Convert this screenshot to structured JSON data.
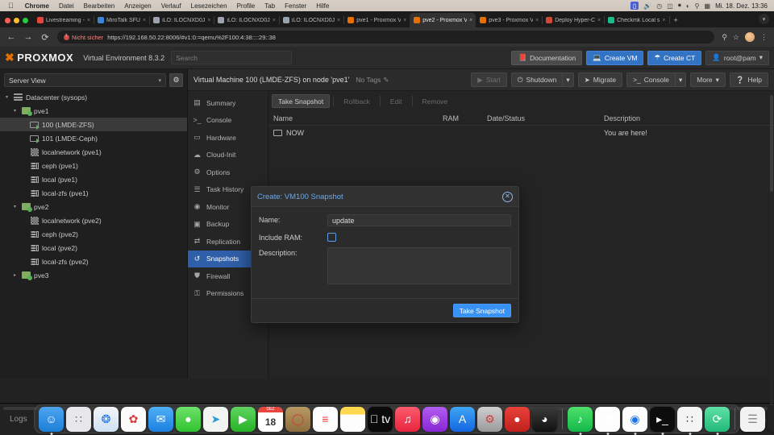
{
  "os_menubar": {
    "apple_icon": "apple-icon",
    "items": [
      "Chrome",
      "Datei",
      "Bearbeiten",
      "Anzeigen",
      "Verlauf",
      "Lesezeichen",
      "Profile",
      "Tab",
      "Fenster",
      "Hilfe"
    ],
    "status_icons": [
      "screen-share-icon",
      "volume-icon",
      "clock-icon",
      "battery-icon",
      "control-center-icon",
      "wifi-icon",
      "spotlight-icon",
      "display-icon"
    ],
    "clock": "Mi. 18. Dez.  13:36"
  },
  "browser": {
    "tabs": [
      {
        "title": "Livestreaming - ",
        "favicon": "#e8443a",
        "active": false
      },
      {
        "title": "MiroTalk SFU",
        "favicon": "#3a86d6",
        "active": false
      },
      {
        "title": "iLO: ILOCNXD0J",
        "favicon": "#9aa3ad",
        "active": false
      },
      {
        "title": "iLO: ILOCNXD0J",
        "favicon": "#9aa3ad",
        "active": false
      },
      {
        "title": "iLO: ILOCNXD0J",
        "favicon": "#9aa3ad",
        "active": false
      },
      {
        "title": "pve1 - Proxmox V",
        "favicon": "#e57000",
        "active": false
      },
      {
        "title": "pve2 - Proxmox V",
        "favicon": "#e57000",
        "active": true
      },
      {
        "title": "pve3 - Proxmox V",
        "favicon": "#e57000",
        "active": false
      },
      {
        "title": "Deploy Hyper-C",
        "favicon": "#d04a3a",
        "active": false
      },
      {
        "title": "Checkmk Local s",
        "favicon": "#1abb8b",
        "active": false
      }
    ],
    "new_tab_label": "+",
    "close_label": "×",
    "back_icon": "back-arrow-icon",
    "forward_icon": "forward-arrow-icon",
    "reload_icon": "reload-icon",
    "security_label": "Nicht sicher",
    "url": "https://192.168.50.22:8006/#v1:0:=qemu%2F100:4:38::::29::38",
    "zoom_icon": "zoom-search-icon",
    "bookmark_icon": "star-icon",
    "profile_icon": "avatar-icon",
    "menu_icon": "kebab-menu-icon"
  },
  "pve_header": {
    "logo_text": "PROXMOX",
    "product": "Virtual Environment 8.3.2",
    "search_placeholder": "Search",
    "documentation": "Documentation",
    "create_vm": "Create VM",
    "create_ct": "Create CT",
    "user": "root@pam"
  },
  "sidebar": {
    "view_label": "Server View",
    "gear_icon": "gear-icon",
    "tree": [
      {
        "label": "Datacenter (sysops)",
        "icon": "datacenter-icon",
        "indent": 0,
        "arrow": "down",
        "selected": false
      },
      {
        "label": "pve1",
        "icon": "node-icon",
        "indent": 1,
        "arrow": "down",
        "selected": false
      },
      {
        "label": "100 (LMDE-ZFS)",
        "icon": "vm-icon",
        "indent": 2,
        "arrow": "none",
        "selected": true
      },
      {
        "label": "101 (LMDE-Ceph)",
        "icon": "vm-icon",
        "indent": 2,
        "arrow": "none",
        "selected": false
      },
      {
        "label": "localnetwork (pve1)",
        "icon": "network-icon",
        "indent": 2,
        "arrow": "none",
        "selected": false
      },
      {
        "label": "ceph (pve1)",
        "icon": "storage-icon",
        "indent": 2,
        "arrow": "none",
        "selected": false
      },
      {
        "label": "local (pve1)",
        "icon": "storage-icon",
        "indent": 2,
        "arrow": "none",
        "selected": false
      },
      {
        "label": "local-zfs (pve1)",
        "icon": "storage-icon",
        "indent": 2,
        "arrow": "none",
        "selected": false
      },
      {
        "label": "pve2",
        "icon": "node-icon",
        "indent": 1,
        "arrow": "down",
        "selected": false
      },
      {
        "label": "localnetwork (pve2)",
        "icon": "network-icon",
        "indent": 2,
        "arrow": "none",
        "selected": false
      },
      {
        "label": "ceph (pve2)",
        "icon": "storage-icon",
        "indent": 2,
        "arrow": "none",
        "selected": false
      },
      {
        "label": "local (pve2)",
        "icon": "storage-icon",
        "indent": 2,
        "arrow": "none",
        "selected": false
      },
      {
        "label": "local-zfs (pve2)",
        "icon": "storage-icon",
        "indent": 2,
        "arrow": "none",
        "selected": false
      },
      {
        "label": "pve3",
        "icon": "node-icon",
        "indent": 1,
        "arrow": "right",
        "selected": false
      }
    ]
  },
  "vm_bar": {
    "title": "Virtual Machine 100 (LMDE-ZFS) on node 'pve1'",
    "tags_label": "No Tags",
    "tags_edit_icon": "pencil-icon",
    "start": "Start",
    "shutdown": "Shutdown",
    "migrate": "Migrate",
    "console": "Console",
    "more": "More",
    "help": "Help"
  },
  "vm_nav": [
    {
      "label": "Summary",
      "icon": "summary-icon",
      "active": false
    },
    {
      "label": "Console",
      "icon": "terminal-icon",
      "active": false
    },
    {
      "label": "Hardware",
      "icon": "monitor-icon",
      "active": false
    },
    {
      "label": "Cloud-Init",
      "icon": "cloud-icon",
      "active": false
    },
    {
      "label": "Options",
      "icon": "gear-icon",
      "active": false
    },
    {
      "label": "Task History",
      "icon": "list-icon",
      "active": false
    },
    {
      "label": "Monitor",
      "icon": "eye-icon",
      "active": false
    },
    {
      "label": "Backup",
      "icon": "floppy-icon",
      "active": false
    },
    {
      "label": "Replication",
      "icon": "replication-icon",
      "active": false
    },
    {
      "label": "Snapshots",
      "icon": "history-icon",
      "active": true
    },
    {
      "label": "Firewall",
      "icon": "shield-icon",
      "active": false
    },
    {
      "label": "Permissions",
      "icon": "lock-icon",
      "active": false
    }
  ],
  "snapshots": {
    "toolbar": [
      {
        "label": "Take Snapshot",
        "enabled": true
      },
      {
        "label": "Rollback",
        "enabled": false
      },
      {
        "label": "Edit",
        "enabled": false
      },
      {
        "label": "Remove",
        "enabled": false
      }
    ],
    "columns": [
      "Name",
      "RAM",
      "Date/Status",
      "Description"
    ],
    "rows": [
      {
        "name": "NOW",
        "icon": "monitor-icon",
        "ram": "",
        "date_status": "",
        "description": "You are here!"
      }
    ]
  },
  "dialog": {
    "title": "Create: VM100 Snapshot",
    "close_icon": "close-icon",
    "fields": {
      "name_label": "Name:",
      "name_value": "update",
      "include_ram_label": "Include RAM:",
      "include_ram_checked": false,
      "description_label": "Description:",
      "description_value": ""
    },
    "submit": "Take Snapshot"
  },
  "logs": {
    "title": "Logs",
    "expand_icon": "chevron-up-icon"
  },
  "dock": {
    "apps": [
      {
        "name": "finder",
        "glyph": "☺",
        "bg": "linear-gradient(180deg,#4ea4f0,#1b7fd6)",
        "running": true
      },
      {
        "name": "launchpad",
        "glyph": "∷",
        "bg": "#e8e8ec",
        "running": false
      },
      {
        "name": "safari",
        "glyph": "❂",
        "bg": "linear-gradient(180deg,#f2f5f8,#cfe0f2)",
        "running": false
      },
      {
        "name": "photos",
        "glyph": "✿",
        "bg": "#fbfbfb",
        "running": false
      },
      {
        "name": "mail",
        "glyph": "✉",
        "bg": "linear-gradient(180deg,#4fb0f5,#1c7fe0)",
        "running": false
      },
      {
        "name": "messages",
        "glyph": "●",
        "bg": "linear-gradient(180deg,#6ee06a,#31c431)",
        "running": false
      },
      {
        "name": "maps",
        "glyph": "➤",
        "bg": "#f2f4f2",
        "running": false
      },
      {
        "name": "facetime",
        "glyph": "▶",
        "bg": "linear-gradient(180deg,#5fd45f,#27b327)",
        "running": false
      },
      {
        "name": "calendar",
        "glyph": "18",
        "bg": "#ffffff",
        "running": false
      },
      {
        "name": "contacts",
        "glyph": "◯",
        "bg": "linear-gradient(180deg,#b99a62,#8d6f3f)",
        "running": false
      },
      {
        "name": "reminders",
        "glyph": "≡",
        "bg": "#fcfcfc",
        "running": false
      },
      {
        "name": "notes",
        "glyph": "",
        "bg": "linear-gradient(180deg,#ffd84d 0 30%,#fdfdfd 30%)",
        "running": false
      },
      {
        "name": "tv",
        "glyph": " tv",
        "bg": "#0a0a0a",
        "running": false
      },
      {
        "name": "music",
        "glyph": "♫",
        "bg": "linear-gradient(180deg,#fb5b6d,#e8253f)",
        "running": false
      },
      {
        "name": "podcasts",
        "glyph": "◉",
        "bg": "linear-gradient(180deg,#b35cf0,#8726d6)",
        "running": false
      },
      {
        "name": "app-store",
        "glyph": "A",
        "bg": "linear-gradient(180deg,#3fa5f5,#1466e0)",
        "running": false
      },
      {
        "name": "system-settings",
        "glyph": "⚙",
        "bg": "linear-gradient(180deg,#cfcfcf,#9a9a9a)",
        "running": false
      },
      {
        "name": "keeper",
        "glyph": "●",
        "bg": "linear-gradient(180deg,#e8413a,#c0211c)",
        "running": false
      },
      {
        "name": "quicklook",
        "glyph": "◕",
        "bg": "linear-gradient(180deg,#3a3a3a,#121212)",
        "running": false
      },
      {
        "name": "spotify",
        "glyph": "♪",
        "bg": "linear-gradient(180deg,#4ce06a,#15b84a)",
        "running": true
      },
      {
        "name": "red-flower-app",
        "glyph": "✸",
        "bg": "#fdfdfd",
        "running": true
      },
      {
        "name": "chrome",
        "glyph": "◉",
        "bg": "#fdfdfd",
        "running": true
      },
      {
        "name": "terminal",
        "glyph": "▸_",
        "bg": "#0d0d0d",
        "running": true
      },
      {
        "name": "calculator",
        "glyph": "∷",
        "bg": "#f4f4f4",
        "running": true
      },
      {
        "name": "sync-app",
        "glyph": "⟳",
        "bg": "linear-gradient(180deg,#5fe0a5,#22b97a)",
        "running": true
      },
      {
        "name": "document-file",
        "glyph": "☰",
        "bg": "#f2f2f2",
        "running": false
      },
      {
        "name": "downloads-stack",
        "glyph": "░",
        "bg": "transparent",
        "running": false
      },
      {
        "name": "trash",
        "glyph": "ᵜ",
        "bg": "linear-gradient(180deg,#c9c9c9,#8f8f8f)",
        "running": false
      }
    ]
  }
}
